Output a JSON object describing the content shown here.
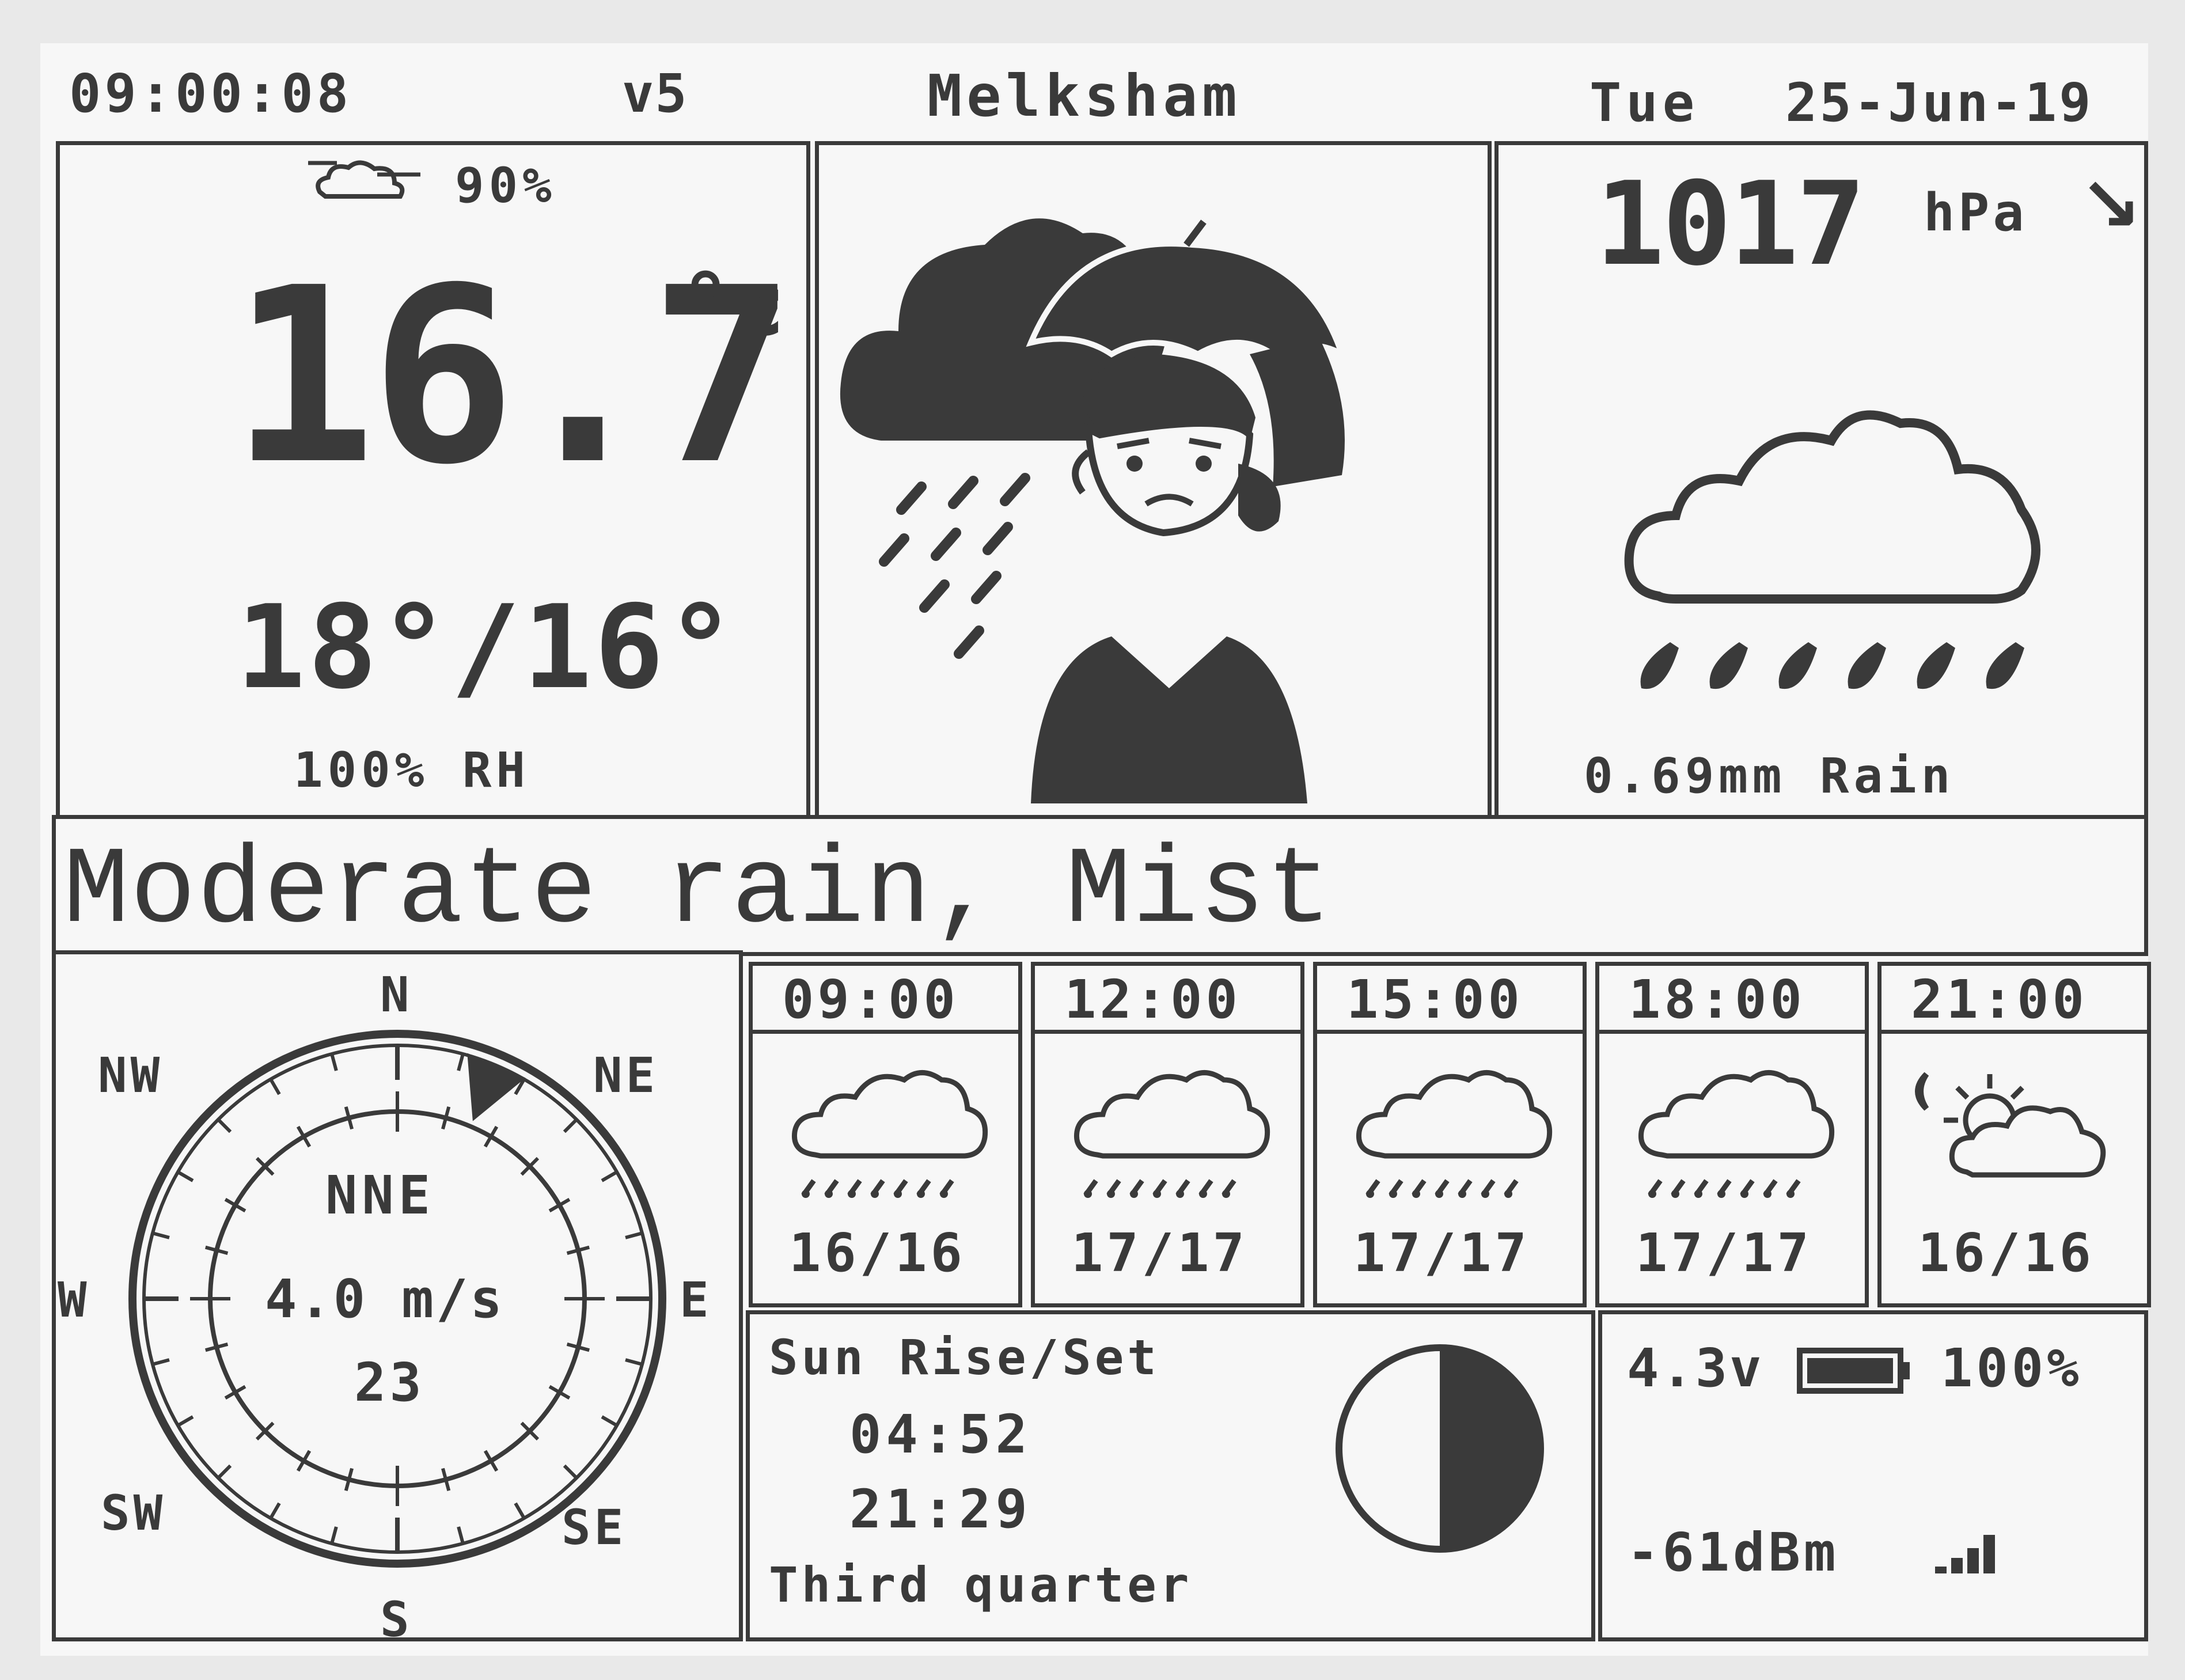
{
  "header": {
    "time": "09:00:08",
    "version": "v5",
    "location": "Melksham",
    "day": "Tue",
    "date": "25-Jun-19"
  },
  "current": {
    "cloud_cover": "90%",
    "temperature": "16.7",
    "temp_unit": "°c",
    "high_low": "18°/16°",
    "humidity": "100% RH"
  },
  "pressure": {
    "value": "1017",
    "unit": "hPa",
    "trend": "↘",
    "rain": "0.69mm Rain"
  },
  "icons": {
    "main": "rain-person-umbrella-icon",
    "secondary": "rain-cloud-icon"
  },
  "description": "Moderate rain, Mist",
  "wind": {
    "compass_labels": {
      "n": "N",
      "ne": "NE",
      "e": "E",
      "se": "SE",
      "s": "S",
      "sw": "SW",
      "w": "W",
      "nw": "NW"
    },
    "direction": "NNE",
    "speed": "4.0 m/s",
    "bearing": "23",
    "bearing_degrees": 23
  },
  "forecast": [
    {
      "time": "09:00",
      "temps": "16/16",
      "icon": "rain-cloud-icon"
    },
    {
      "time": "12:00",
      "temps": "17/17",
      "icon": "rain-cloud-icon"
    },
    {
      "time": "15:00",
      "temps": "17/17",
      "icon": "rain-cloud-icon"
    },
    {
      "time": "18:00",
      "temps": "17/17",
      "icon": "rain-cloud-icon"
    },
    {
      "time": "21:00",
      "temps": "16/16",
      "icon": "moon-sun-cloud-icon"
    }
  ],
  "astro": {
    "title": "Sun Rise/Set",
    "sunrise": "04:52",
    "sunset": "21:29",
    "moon_phase": "Third quarter"
  },
  "device": {
    "voltage": "4.3v",
    "battery": "100%",
    "signal": "-61dBm"
  },
  "colors": {
    "ink": "#3a3a3a",
    "paper": "#f7f7f7"
  }
}
